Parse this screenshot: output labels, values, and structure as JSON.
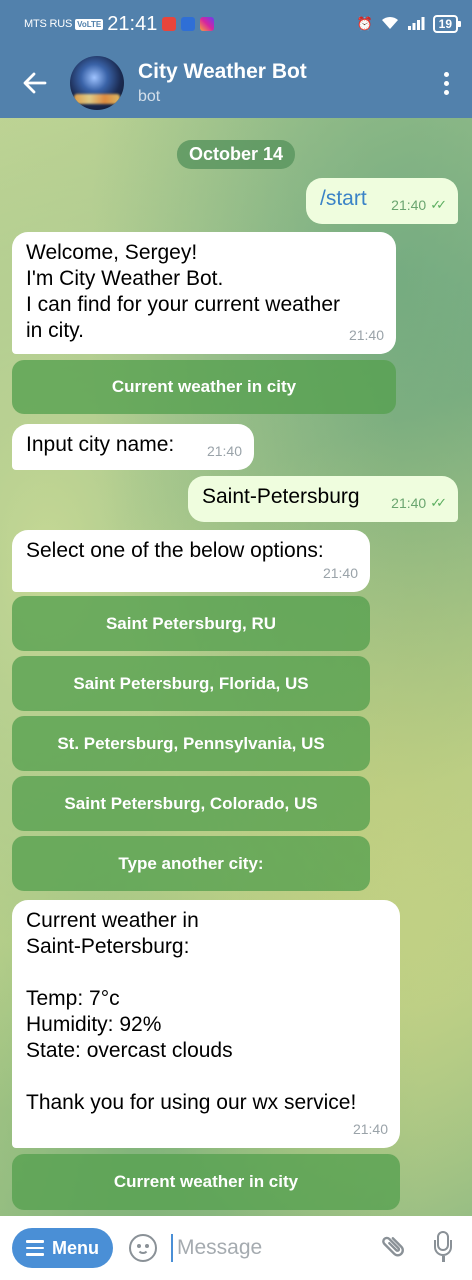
{
  "status_bar": {
    "carrier": "MTS RUS",
    "volte": "VoLTE",
    "time": "21:41",
    "battery": "19"
  },
  "header": {
    "title": "City Weather Bot",
    "subtitle": "bot"
  },
  "chat": {
    "date": "October 14",
    "messages": [
      {
        "text": "/start",
        "time": "21:40"
      },
      {
        "text": "Welcome, Sergey!\nI'm City Weather Bot.\nI can find for your current weather\nin city.",
        "time": "21:40"
      },
      {
        "text": "Input city name:",
        "time": "21:40"
      },
      {
        "text": "Saint-Petersburg",
        "time": "21:40"
      },
      {
        "text": "Select one of the below options:",
        "time": "21:40"
      },
      {
        "text": "Current weather in\nSaint-Petersburg:\n\nTemp: 7°c\nHumidity: 92%\nState: overcast clouds\n\nThank you for using our wx service!",
        "time": "21:40"
      }
    ],
    "buttons": {
      "current_weather_1": "Current weather in city",
      "options": [
        "Saint Petersburg, RU",
        "Saint Petersburg, Florida, US",
        "St. Petersburg, Pennsylvania, US",
        "Saint Petersburg, Colorado, US",
        "Type another city:"
      ],
      "current_weather_2": "Current weather in city"
    }
  },
  "input_bar": {
    "menu_label": "Menu",
    "placeholder": "Message"
  },
  "colors": {
    "header": "#5281ac",
    "keyboard_button": "#56a050",
    "menu_button": "#4a8fd6",
    "outgoing_bubble": "#effdde"
  }
}
